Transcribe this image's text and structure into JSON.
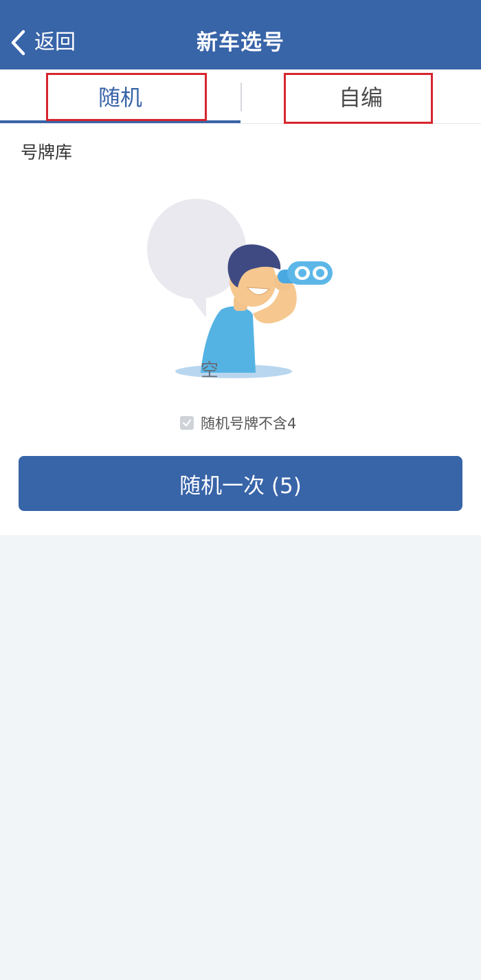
{
  "header": {
    "back_label": "返回",
    "title": "新车选号",
    "back_icon": "chevron-left-icon"
  },
  "tabs": [
    {
      "label": "随机",
      "active": true
    },
    {
      "label": "自编",
      "active": false
    }
  ],
  "section": {
    "label": "号牌库"
  },
  "empty_state": {
    "text": "空",
    "illustration": "person-with-binoculars"
  },
  "options": {
    "exclude_four_label": "随机号牌不含4",
    "exclude_four_checked": true
  },
  "action": {
    "random_button_label": "随机一次 (5)"
  },
  "colors": {
    "primary": "#3864a8",
    "highlight": "#d6252d",
    "background": "#f1f5f7"
  }
}
